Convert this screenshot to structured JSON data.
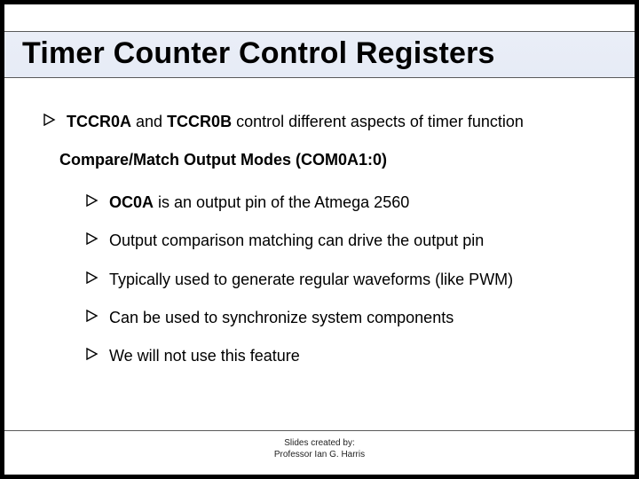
{
  "title": "Timer Counter Control Registers",
  "bullets": {
    "intro_prefix": "TCCR0A",
    "intro_mid": " and ",
    "intro_bold2": "TCCR0B",
    "intro_rest": " control different aspects of timer function",
    "subheading": "Compare/Match Output Modes (COM0A1:0)",
    "b1_prefix": "OC0A",
    "b1_rest": " is an output pin of the Atmega 2560",
    "b2": "Output comparison matching can drive the output pin",
    "b3": "Typically used to generate regular waveforms (like PWM)",
    "b4": "Can be used to synchronize system components",
    "b5": "We will not use this feature"
  },
  "footer": {
    "line1": "Slides created by:",
    "line2": "Professor Ian G. Harris"
  }
}
